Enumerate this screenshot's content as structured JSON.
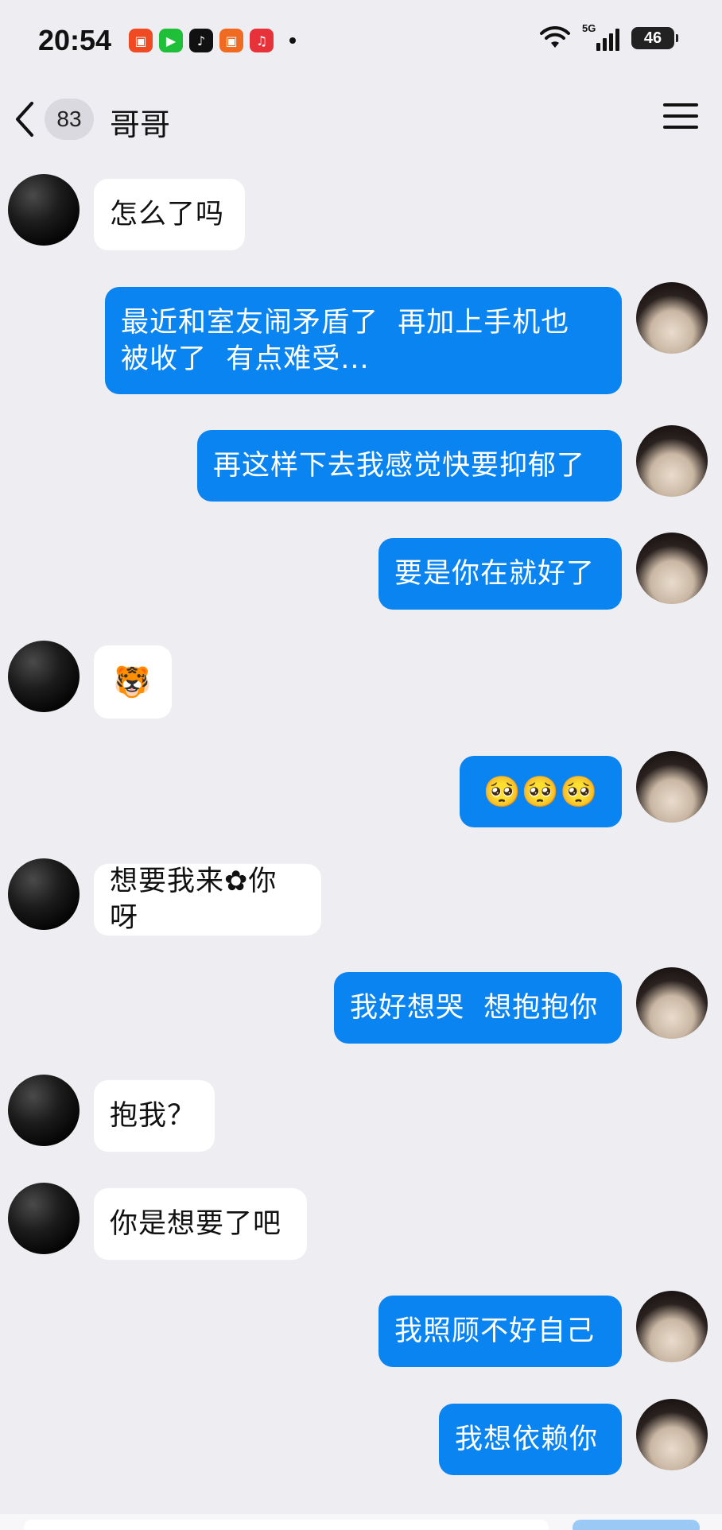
{
  "status": {
    "time": "20:54",
    "network": "5G",
    "battery": "46",
    "apps": [
      {
        "name": "kuaishou-icon",
        "color": "#f04a22",
        "glyph": "▣"
      },
      {
        "name": "live-icon",
        "color": "#1fbf3a",
        "glyph": "▶"
      },
      {
        "name": "tiktok-icon",
        "color": "#111111",
        "glyph": "♪"
      },
      {
        "name": "kuaishou-speed-icon",
        "color": "#f06a22",
        "glyph": "▣"
      },
      {
        "name": "music-icon",
        "color": "#e8323a",
        "glyph": "♫"
      }
    ]
  },
  "header": {
    "unread_count": "83",
    "contact_name": "哥哥"
  },
  "messages": [
    {
      "side": "left",
      "text": "怎么了吗"
    },
    {
      "side": "right",
      "text": "最近和室友闹矛盾了  再加上手机也\n被收了  有点难受..."
    },
    {
      "side": "right",
      "text": "再这样下去我感觉快要抑郁了"
    },
    {
      "side": "right",
      "text": "要是你在就好了"
    },
    {
      "side": "left",
      "text": "🐯"
    },
    {
      "side": "right",
      "text": "🥺🥺🥺"
    },
    {
      "side": "left",
      "text": "想要我来✿你呀"
    },
    {
      "side": "right",
      "text": "我好想哭  想抱抱你"
    },
    {
      "side": "left",
      "text": "抱我？"
    },
    {
      "side": "left",
      "text": "你是想要了吧"
    },
    {
      "side": "right",
      "text": "我照顾不好自己"
    },
    {
      "side": "right",
      "text": "我想依赖你"
    }
  ]
}
